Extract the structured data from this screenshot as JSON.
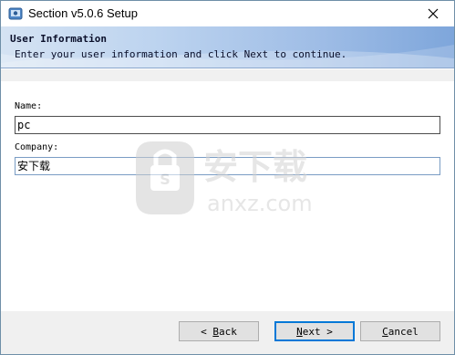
{
  "window": {
    "title": "Section v5.0.6 Setup"
  },
  "banner": {
    "title": "User Information",
    "subtitle": "Enter your user information and click Next to continue."
  },
  "form": {
    "name_label": "Name:",
    "name_value": "pc",
    "company_label": "Company:",
    "company_value": "安下载"
  },
  "watermark": {
    "text": "安下载",
    "domain": "anxz.com"
  },
  "buttons": {
    "back": {
      "prefix": "< ",
      "accel": "B",
      "rest": "ack"
    },
    "next": {
      "prefix": "",
      "accel": "N",
      "rest": "ext >"
    },
    "cancel": {
      "prefix": "",
      "accel": "C",
      "rest": "ancel"
    }
  },
  "colors": {
    "accent": "#0078d7",
    "banner_start": "#d5e3f3",
    "banner_end": "#7ea6db"
  }
}
